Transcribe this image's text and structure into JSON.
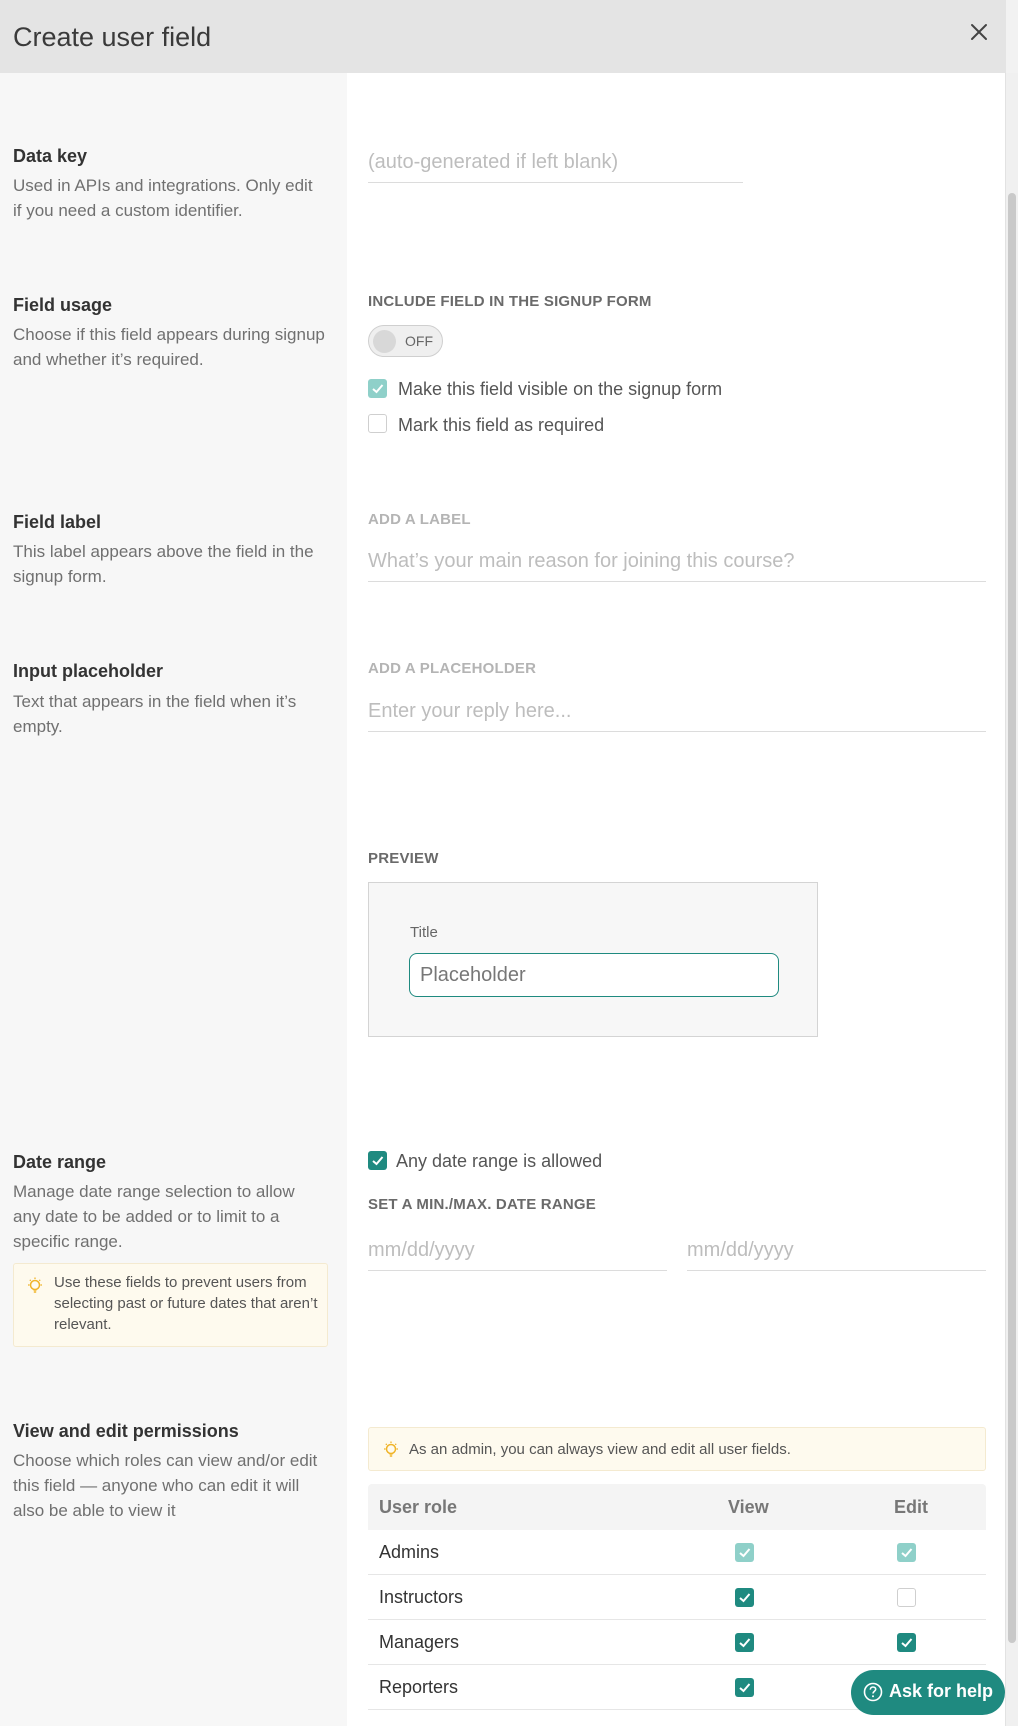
{
  "dialog": {
    "title": "Create user field"
  },
  "data_key": {
    "title": "Data key",
    "desc": "Used in APIs and integrations. Only edit if you need a custom identifier.",
    "input_placeholder": "(auto-generated if left blank)"
  },
  "field_usage": {
    "title": "Field usage",
    "desc": "Choose if this field appears during signup and whether it’s required.",
    "caption": "INCLUDE FIELD IN THE SIGNUP FORM",
    "toggle_label": "OFF",
    "toggle_on": false,
    "visible_label": "Make this field visible on the signup form",
    "visible_checked": true,
    "required_label": "Mark this field as required",
    "required_checked": false
  },
  "field_label": {
    "title": "Field label",
    "desc": "This label appears above the field in the signup form.",
    "caption": "ADD A LABEL",
    "input_placeholder": "What’s your main reason for joining this course?"
  },
  "input_placeholder": {
    "title": "Input placeholder",
    "desc": "Text that appears in the field when it’s empty.",
    "caption": "ADD A PLACEHOLDER",
    "input_placeholder": "Enter your reply here..."
  },
  "preview": {
    "caption": "PREVIEW",
    "field_title": "Title",
    "field_placeholder": "Placeholder"
  },
  "date_range": {
    "title": "Date range",
    "desc": "Manage date range selection to allow any date to be added or to limit to a specific range.",
    "tip": "Use these fields to prevent users from selecting past or future dates that aren’t relevant.",
    "any_label": "Any date range is allowed",
    "any_checked": true,
    "caption": "SET A MIN./MAX. DATE RANGE",
    "min_placeholder": "mm/dd/yyyy",
    "max_placeholder": "mm/dd/yyyy"
  },
  "permissions": {
    "title": "View and edit permissions",
    "desc": "Choose which roles can view and/or edit this field — anyone who can edit it will also be able to view it",
    "admin_tip": "As an admin, you can always view and edit all user fields.",
    "columns": {
      "role": "User role",
      "view": "View",
      "edit": "Edit"
    },
    "rows": [
      {
        "role": "Admins",
        "view": true,
        "edit": true,
        "locked": true
      },
      {
        "role": "Instructors",
        "view": true,
        "edit": false,
        "locked": false
      },
      {
        "role": "Managers",
        "view": true,
        "edit": true,
        "locked": false
      },
      {
        "role": "Reporters",
        "view": true,
        "edit": null,
        "locked": false
      }
    ]
  },
  "help_button": {
    "label": "Ask for help"
  },
  "colors": {
    "accent": "#1f8a80",
    "accent_light": "#8fd0c9",
    "tip_bg": "#fefaee"
  }
}
